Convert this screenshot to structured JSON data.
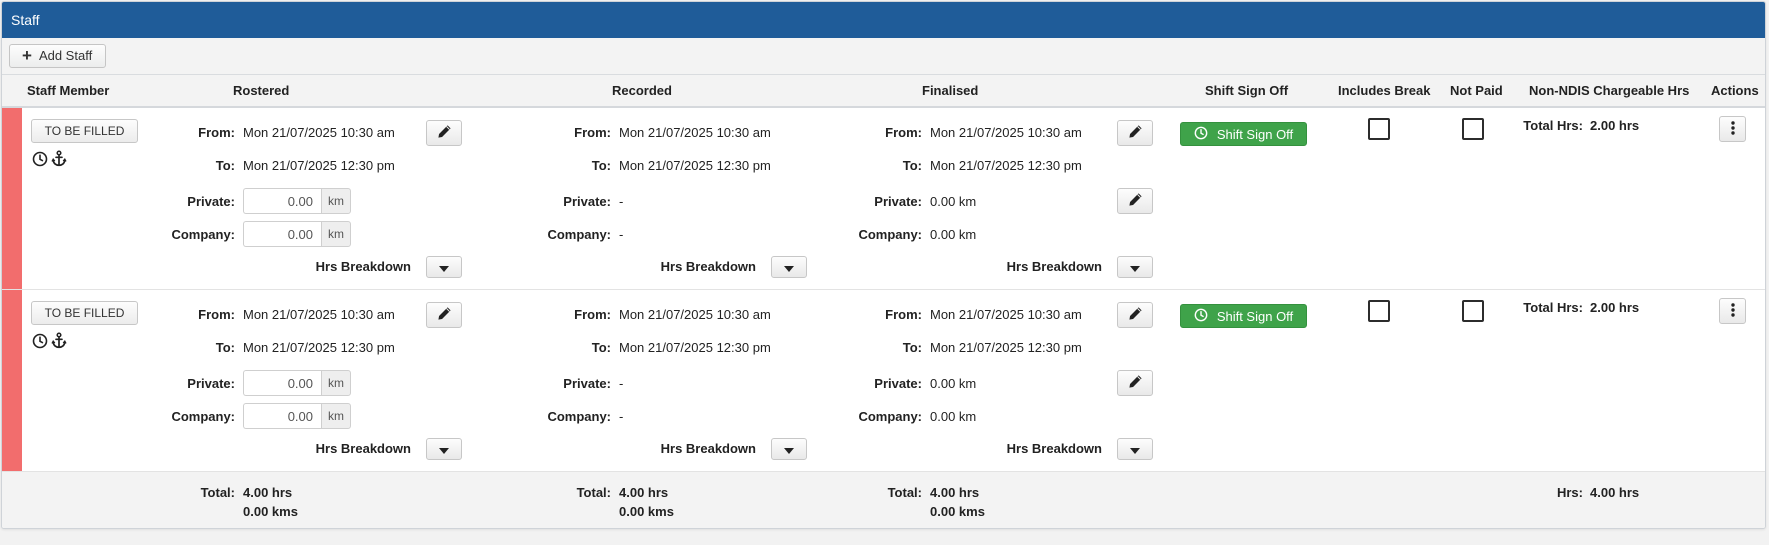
{
  "panel": {
    "title": "Staff"
  },
  "toolbar": {
    "add_staff_label": "Add Staff"
  },
  "columns": {
    "staff_member": "Staff Member",
    "rostered": "Rostered",
    "recorded": "Recorded",
    "finalised": "Finalised",
    "shift_sign_off": "Shift Sign Off",
    "includes_break": "Includes Break",
    "not_paid": "Not Paid",
    "non_ndis_hrs": "Non-NDIS Chargeable Hrs",
    "actions": "Actions"
  },
  "labels": {
    "from": "From:",
    "to": "To:",
    "private": "Private:",
    "company": "Company:",
    "hrs_breakdown": "Hrs Breakdown",
    "km_unit": "km",
    "total_hrs": "Total Hrs:",
    "sign_off": "Shift Sign Off"
  },
  "rows": [
    {
      "staff_label": "TO BE FILLED",
      "rostered": {
        "from": "Mon 21/07/2025 10:30 am",
        "to": "Mon 21/07/2025 12:30 pm",
        "private_km": "0.00",
        "company_km": "0.00"
      },
      "recorded": {
        "from": "Mon 21/07/2025 10:30 am",
        "to": "Mon 21/07/2025 12:30 pm",
        "private": "-",
        "company": "-"
      },
      "finalised": {
        "from": "Mon 21/07/2025 10:30 am",
        "to": "Mon 21/07/2025 12:30 pm",
        "private": "0.00 km",
        "company": "0.00 km"
      },
      "includes_break": false,
      "not_paid": false,
      "total_hrs": "2.00 hrs"
    },
    {
      "staff_label": "TO BE FILLED",
      "rostered": {
        "from": "Mon 21/07/2025 10:30 am",
        "to": "Mon 21/07/2025 12:30 pm",
        "private_km": "0.00",
        "company_km": "0.00"
      },
      "recorded": {
        "from": "Mon 21/07/2025 10:30 am",
        "to": "Mon 21/07/2025 12:30 pm",
        "private": "-",
        "company": "-"
      },
      "finalised": {
        "from": "Mon 21/07/2025 10:30 am",
        "to": "Mon 21/07/2025 12:30 pm",
        "private": "0.00 km",
        "company": "0.00 km"
      },
      "includes_break": false,
      "not_paid": false,
      "total_hrs": "2.00 hrs"
    }
  ],
  "footer": {
    "total_label": "Total:",
    "hrs_label": "Hrs:",
    "rostered": {
      "hrs": "4.00 hrs",
      "kms": "0.00 kms"
    },
    "recorded": {
      "hrs": "4.00 hrs",
      "kms": "0.00 kms"
    },
    "finalised": {
      "hrs": "4.00 hrs",
      "kms": "0.00 kms"
    },
    "non_ndis_hrs": "4.00 hrs"
  },
  "colors": {
    "header_bg": "#1f5c99",
    "status_bar": "#f26d6d",
    "sign_off_green": "#3fa34a"
  },
  "icons": {
    "add": "plus-icon",
    "status": [
      "clock-icon",
      "anchor-icon"
    ],
    "edit": "pencil-icon",
    "expand": "caret-down-icon",
    "sign_off": "clock-icon",
    "actions": "vertical-ellipsis-icon"
  }
}
